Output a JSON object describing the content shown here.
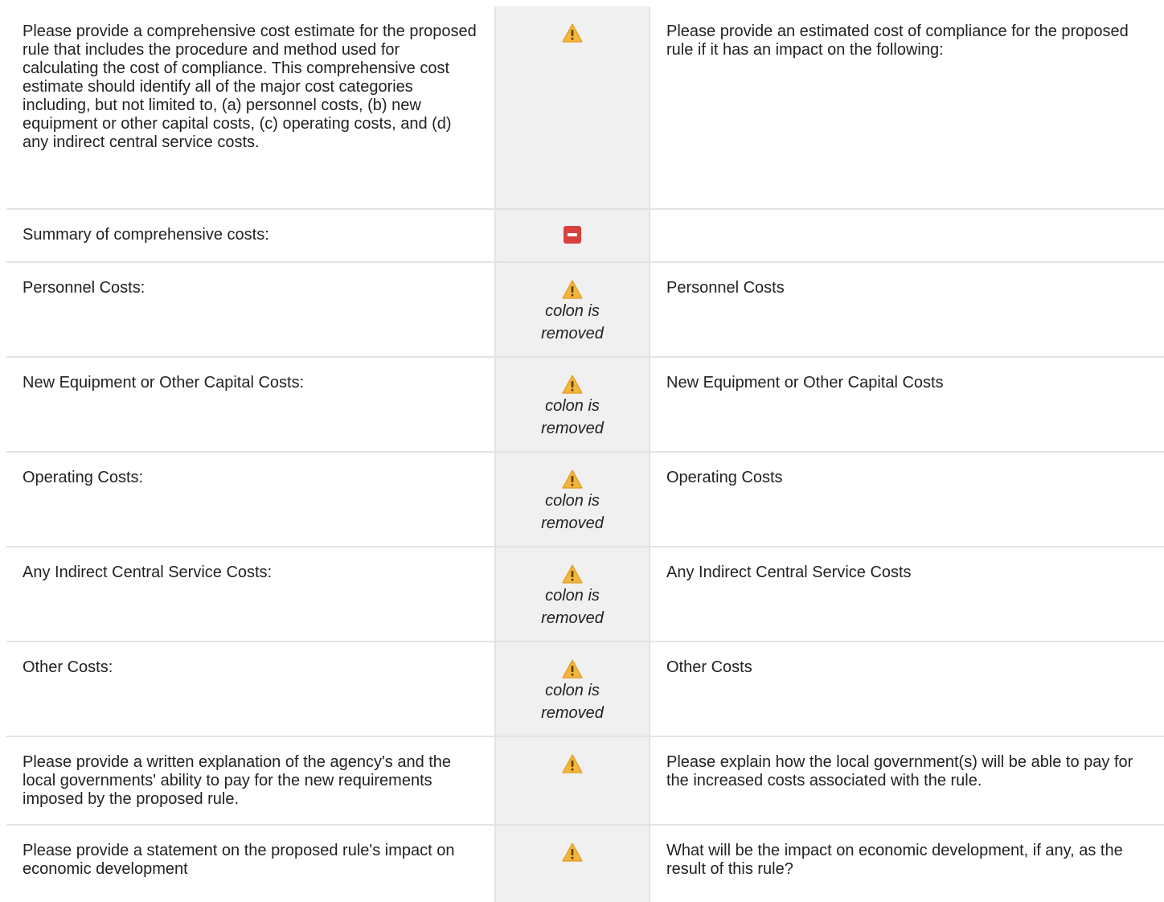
{
  "colors": {
    "warning": "#f3b53b",
    "removed": "#d9413f",
    "flag_column_bg": "#f0f0f0",
    "row_border": "#e3e3e3"
  },
  "rows": [
    {
      "old_text": "Please provide a comprehensive cost estimate for the proposed rule that includes the procedure and method used for calculating the cost of compliance. This comprehensive cost estimate should identify all of the major cost categories including, but not limited to, (a) personnel costs, (b) new equipment or other capital costs, (c) operating costs, and (d) any indirect central service costs.",
      "flag": "warning-icon",
      "note": "",
      "new_text": "Please provide an estimated cost of compliance for the proposed rule if it has an impact on the following:"
    },
    {
      "old_text": "Summary of comprehensive costs:",
      "flag": "removed-icon",
      "note": "",
      "new_text": ""
    },
    {
      "old_text": "Personnel Costs:",
      "flag": "warning-icon",
      "note": "colon is removed",
      "new_text": "Personnel Costs"
    },
    {
      "old_text": "New Equipment or Other Capital Costs:",
      "flag": "warning-icon",
      "note": "colon is removed",
      "new_text": "New Equipment or Other Capital Costs"
    },
    {
      "old_text": "Operating Costs:",
      "flag": "warning-icon",
      "note": "colon is removed",
      "new_text": "Operating Costs"
    },
    {
      "old_text": "Any Indirect Central Service Costs:",
      "flag": "warning-icon",
      "note": "colon is removed",
      "new_text": "Any Indirect Central Service Costs"
    },
    {
      "old_text": "Other Costs:",
      "flag": "warning-icon",
      "note": "colon is removed",
      "new_text": "Other Costs"
    },
    {
      "old_text": "Please provide a written explanation of the agency's and the local governments' ability to pay for the new requirements imposed by the proposed rule.",
      "flag": "warning-icon",
      "note": "",
      "new_text": "Please explain how the local government(s) will be able to pay for the increased costs associated with the rule."
    },
    {
      "old_text": "Please provide a statement on the proposed rule's impact on economic development",
      "flag": "warning-icon",
      "note": "",
      "new_text": "What will be the impact on economic development, if any, as the result of this rule?"
    }
  ]
}
